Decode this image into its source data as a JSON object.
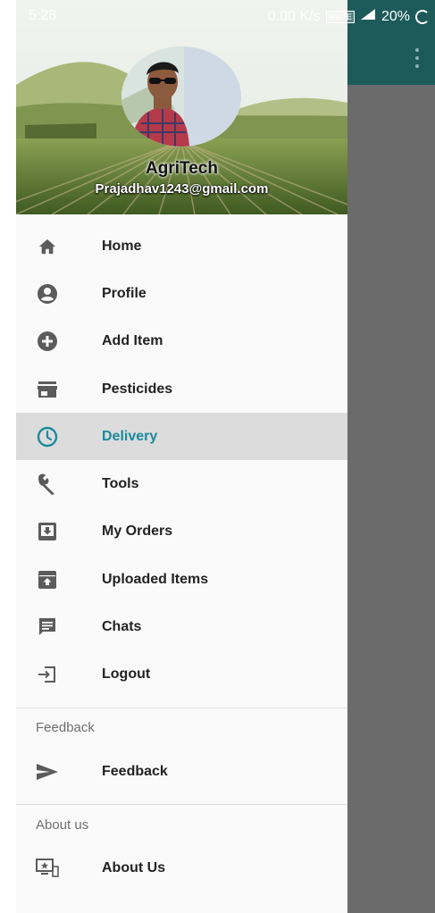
{
  "status_bar": {
    "time": "5:28",
    "network_speed": "0.00 K/s",
    "volte": "VoLTE",
    "battery": "20%"
  },
  "header": {
    "name": "AgriTech",
    "email": "Prajadhav1243@gmail.com"
  },
  "menu": {
    "items": [
      {
        "label": "Home",
        "icon": "home-icon"
      },
      {
        "label": "Profile",
        "icon": "profile-icon"
      },
      {
        "label": "Add Item",
        "icon": "add-circle-icon"
      },
      {
        "label": "Pesticides",
        "icon": "store-icon"
      },
      {
        "label": "Delivery",
        "icon": "clock-icon",
        "active": true
      },
      {
        "label": "Tools",
        "icon": "wrench-icon"
      },
      {
        "label": "My Orders",
        "icon": "download-box-icon"
      },
      {
        "label": "Uploaded Items",
        "icon": "upload-box-icon"
      },
      {
        "label": "Chats",
        "icon": "chat-icon"
      },
      {
        "label": "Logout",
        "icon": "logout-icon"
      }
    ]
  },
  "sections": {
    "feedback": {
      "title": "Feedback",
      "item_label": "Feedback"
    },
    "about": {
      "title": "About us",
      "item_label": "About Us"
    }
  },
  "colors": {
    "accent": "#1b8a9c",
    "toolbar": "#1d5a5a",
    "scrim": "#6b6b6b",
    "active_bg": "#dcdcdc"
  }
}
